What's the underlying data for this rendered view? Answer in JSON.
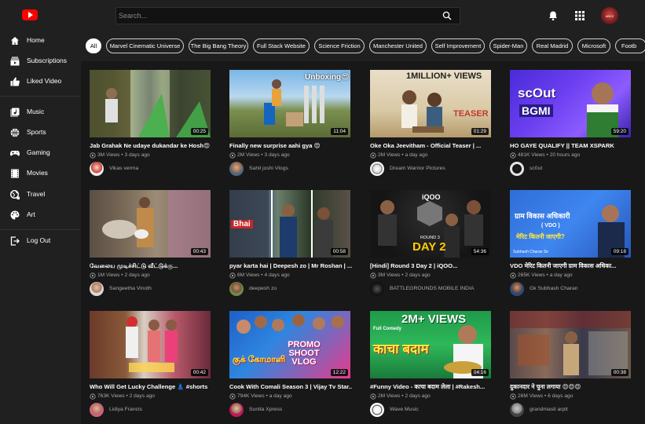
{
  "header": {
    "search_placeholder": "Search...",
    "avatar_text": "ANI.E"
  },
  "sidebar": {
    "items": [
      {
        "label": "Home",
        "icon": "home-icon"
      },
      {
        "label": "Subscriptions",
        "icon": "subscriptions-icon"
      },
      {
        "label": "Liked Video",
        "icon": "thumbs-up-icon"
      },
      {
        "label": "Music",
        "icon": "music-icon"
      },
      {
        "label": "Sports",
        "icon": "sports-icon"
      },
      {
        "label": "Gaming",
        "icon": "gaming-icon"
      },
      {
        "label": "Movies",
        "icon": "movies-icon"
      },
      {
        "label": "Travel",
        "icon": "travel-icon"
      },
      {
        "label": "Art",
        "icon": "art-icon"
      },
      {
        "label": "Log Out",
        "icon": "logout-icon"
      }
    ]
  },
  "chips": [
    "All",
    "Marvel Cinematic Universe",
    "The Big Bang Theory",
    "Full Stack Website",
    "Science Friction",
    "Manchester United",
    "Self Improvement",
    "Spider-Man",
    "Real Madrid",
    "Microsoft",
    "Footb"
  ],
  "videos": [
    {
      "title": "Jab Grahak Ne udaye dukandar ke Hosh😍",
      "views": "3M Views",
      "age": "3 days ago",
      "channel": "Vikas verma",
      "duration": "00:25",
      "overlay": ""
    },
    {
      "title": "Finally new surprise aahi gya 😍",
      "views": "2M Views",
      "age": "3 days ago",
      "channel": "Sahil joshi Vlogs",
      "duration": "11:04",
      "overlay": "Unboxing😍"
    },
    {
      "title": "Oke Oka Jeevitham - Official Teaser | ...",
      "views": "2M Views",
      "age": "a day ago",
      "channel": "Dream Warrior Pictures",
      "duration": "01:29",
      "overlay": "1MILLION+ VIEWS"
    },
    {
      "title": "HO GAYE QUALIFY || TEAM XSPARK",
      "views": "481K Views",
      "age": "20 hours ago",
      "channel": "sc0ut",
      "duration": "59:20",
      "overlay": "scOut"
    },
    {
      "title": "வேலைய முடிச்சிட்டு வீட்டுக்கு...",
      "views": "1M Views",
      "age": "2 days ago",
      "channel": "Sangeetha Vinoth",
      "duration": "00:43",
      "overlay": ""
    },
    {
      "title": "pyar karta hai | Deepesh zo | Mr Roshan | ...",
      "views": "6M Views",
      "age": "4 days ago",
      "channel": "deepesh zo",
      "duration": "00:58",
      "overlay": "Bhai"
    },
    {
      "title": "[Hindi] Round 3 Day 2 | iQOO...",
      "views": "3M Views",
      "age": "2 days ago",
      "channel": "BATTLEGROUNDS MOBILE INDIA",
      "duration": "54:36",
      "overlay": "DAY 2"
    },
    {
      "title": "VDO मेरिट कितनी जाएगी ग्राम विकास अधिका...",
      "views": "265K Views",
      "age": "a day ago",
      "channel": "Gk Subhash Charan",
      "duration": "09:18",
      "overlay": "ग्राम विकास अधिकारी"
    },
    {
      "title": "Who Will Get Lucky Challenge 👗 #shorts",
      "views": "763K Views",
      "age": "2 days ago",
      "channel": "Lidiya Francis",
      "duration": "00:42",
      "overlay": ""
    },
    {
      "title": "Cook With Comali Season 3 | Vijay Tv Star...",
      "views": "794K Views",
      "age": "a day ago",
      "channel": "Sunita Xpress",
      "duration": "12:22",
      "overlay": "PROMO SHOOT VLOG"
    },
    {
      "title": "#Funny Video - काचा बदाम लेला | #Rakesh...",
      "views": "2M Views",
      "age": "2 days ago",
      "channel": "Wave Music",
      "duration": "04:16",
      "overlay": "2M+ VIEWS"
    },
    {
      "title": "दुकानदार ने चुना लगाया 😍😍😍",
      "views": "26M Views",
      "age": "6 days ago",
      "channel": "grandmasti arpit",
      "duration": "00:38",
      "overlay": ""
    }
  ]
}
